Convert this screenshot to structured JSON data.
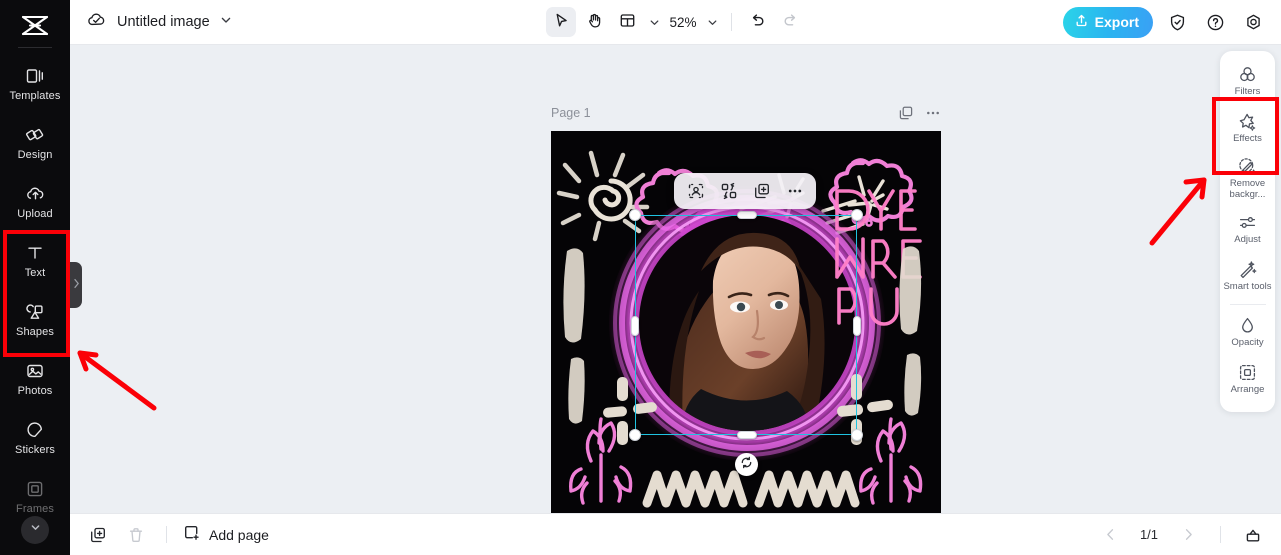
{
  "app": {
    "accent_export_from": "#2ad4e8",
    "accent_export_to": "#3aa0f5",
    "selection_color": "#1fc3e0",
    "annotation_color": "#fb0007"
  },
  "topbar": {
    "cloud_icon": "cloud-check-icon",
    "title": "Untitled image",
    "title_chevron": "chevron-down-icon",
    "tools": [
      {
        "name": "select-tool",
        "icon": "cursor-arrow-icon",
        "active": true
      },
      {
        "name": "hand-tool",
        "icon": "hand-icon",
        "active": false
      },
      {
        "name": "layout-tool",
        "icon": "layout-panel-icon",
        "active": false
      }
    ],
    "layout_chevron": "chevron-down-icon",
    "zoom_level": "52%",
    "zoom_chevron": "chevron-down-icon",
    "undo": {
      "label": "Undo",
      "icon": "undo-icon",
      "disabled": false
    },
    "redo": {
      "label": "Redo",
      "icon": "redo-icon",
      "disabled": true
    },
    "export_label": "Export",
    "export_icon": "export-upload-icon",
    "right_icons": [
      {
        "name": "shield-check-icon"
      },
      {
        "name": "help-question-icon"
      },
      {
        "name": "settings-gear-icon"
      }
    ]
  },
  "sidebar": {
    "logo": "capcut-logo",
    "items": [
      {
        "label": "Templates",
        "icon": "templates-icon",
        "dim": false
      },
      {
        "label": "Design",
        "icon": "design-icon",
        "dim": false
      },
      {
        "label": "Upload",
        "icon": "upload-cloud-icon",
        "dim": false
      },
      {
        "label": "Text",
        "icon": "text-t-icon",
        "dim": false
      },
      {
        "label": "Shapes",
        "icon": "shapes-icon",
        "dim": false
      },
      {
        "label": "Photos",
        "icon": "photos-image-icon",
        "dim": false
      },
      {
        "label": "Stickers",
        "icon": "stickers-icon",
        "dim": false
      },
      {
        "label": "Frames",
        "icon": "frames-icon",
        "dim": true
      }
    ],
    "scroll_down_icon": "chevron-down-circle-icon",
    "collapse_icon": "chevron-right-icon"
  },
  "canvas": {
    "page_label": "Page 1",
    "page_actions": [
      {
        "name": "duplicate-page-icon"
      },
      {
        "name": "more-options-icon"
      }
    ],
    "artwork": {
      "headline_lines": [
        "DIY",
        "MAKE",
        "UP"
      ],
      "headline_color": "#ff7fc8",
      "background": "#050406",
      "neon_ring_color": "#d44bd4"
    },
    "float_toolbar": [
      {
        "name": "select-subject-icon"
      },
      {
        "name": "replace-image-icon"
      },
      {
        "name": "duplicate-icon"
      },
      {
        "name": "more-options-icon"
      }
    ],
    "selection": {
      "rotate_icon": "rotate-icon"
    }
  },
  "right_panel": {
    "items": [
      {
        "label": "Filters",
        "icon": "filters-icon",
        "highlighted": false
      },
      {
        "label": "Effects",
        "icon": "effects-sparkle-icon",
        "highlighted": true
      },
      {
        "label": "Remove backgr...",
        "icon": "remove-background-icon",
        "highlighted": false
      },
      {
        "label": "Adjust",
        "icon": "adjust-sliders-icon",
        "highlighted": false
      },
      {
        "label": "Smart tools",
        "icon": "smart-tools-wand-icon",
        "highlighted": false
      },
      {
        "label": "Opacity",
        "icon": "opacity-drop-icon",
        "highlighted": false
      },
      {
        "label": "Arrange",
        "icon": "arrange-icon",
        "highlighted": false
      }
    ]
  },
  "bottombar": {
    "duplicate_icon": "duplicate-page-icon",
    "delete_icon": "trash-icon",
    "add_page_icon": "add-page-icon",
    "add_page_label": "Add page",
    "prev_icon": "chevron-left-icon",
    "next_icon": "chevron-right-icon",
    "page_indicator": "1/1",
    "present_icon": "present-icon"
  }
}
